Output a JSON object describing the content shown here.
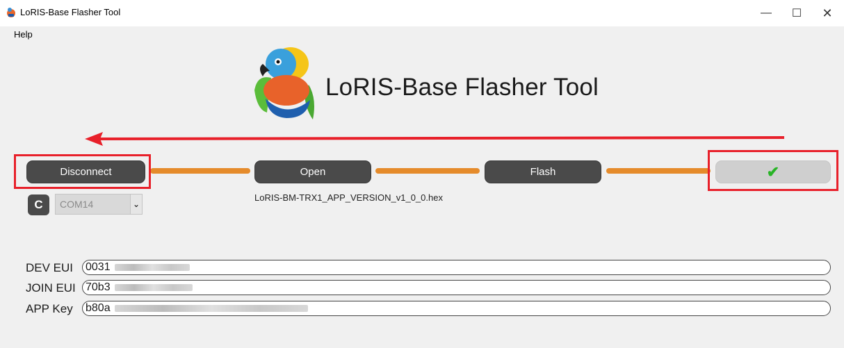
{
  "window": {
    "title": "LoRIS-Base Flasher Tool",
    "min_glyph": "—",
    "max_glyph": "☐",
    "close_glyph": "✕"
  },
  "menu": {
    "help": "Help"
  },
  "header": {
    "app_title": "LoRIS-Base Flasher Tool",
    "logo_icon": "parrot-logo"
  },
  "steps": {
    "disconnect": "Disconnect",
    "open": "Open",
    "flash": "Flash",
    "done_icon": "✔"
  },
  "file": {
    "name": "LoRIS-BM-TRX1_APP_VERSION_v1_0_0.hex"
  },
  "port": {
    "refresh_icon": "C",
    "selected": "COM14",
    "dropdown_glyph": "⌄"
  },
  "fields": [
    {
      "label": "DEV EUI",
      "value": "0031"
    },
    {
      "label": "JOIN EUI",
      "value": "70b3"
    },
    {
      "label": "APP Key",
      "value": "b80a"
    }
  ],
  "colors": {
    "annotation": "#e8202a",
    "connector": "#e58b2b",
    "button": "#4a4a4a",
    "check": "#28b426"
  }
}
